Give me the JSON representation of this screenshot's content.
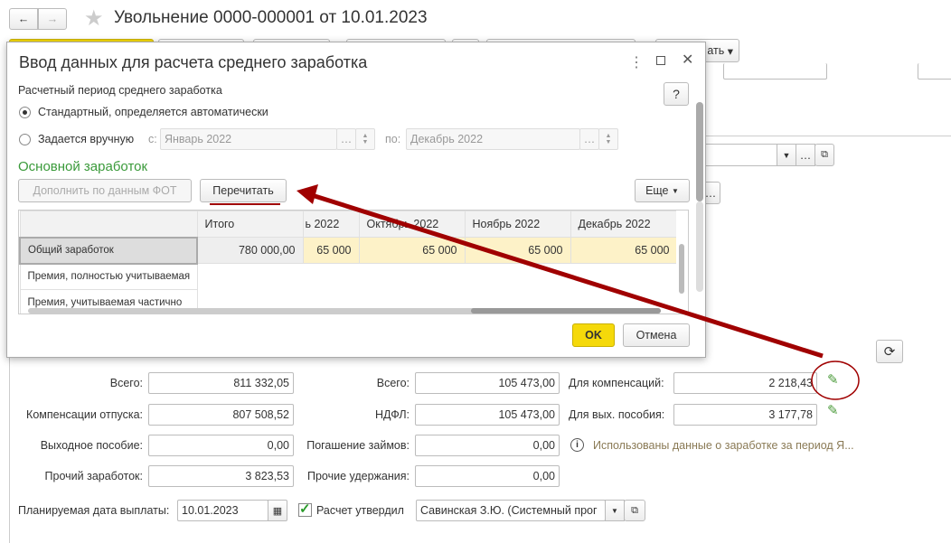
{
  "window": {
    "title": "Увольнение 0000-000001 от 10.01.2023",
    "toolbar_more_label": "ать"
  },
  "dialog": {
    "title": "Ввод данных для расчета среднего заработка",
    "help_label": "?",
    "period_label": "Расчетный период среднего заработка",
    "radio_auto": "Стандартный, определяется автоматически",
    "radio_manual": "Задается вручную",
    "from_label": "с:",
    "from_value": "Январь 2022",
    "to_label": "по:",
    "to_value": "Декабрь 2022",
    "section_title": "Основной заработок",
    "fill_button": "Дополнить по данным ФОТ",
    "recalc_button": "Перечитать",
    "more_button": "Еще",
    "table": {
      "headers": [
        "",
        "Итого",
        "ь 2022",
        "Октябрь 2022",
        "Ноябрь 2022",
        "Декабрь 2022"
      ],
      "rows": [
        [
          "Общий заработок",
          "780 000,00",
          "65 000",
          "65 000",
          "65 000",
          "65 000"
        ],
        [
          "Премия, полностью учитываемая",
          "",
          "",
          "",
          "",
          ""
        ],
        [
          "Премия, учитываемая частично",
          "",
          "",
          "",
          "",
          ""
        ]
      ]
    },
    "ok_button": "OK",
    "cancel_button": "Отмена"
  },
  "form": {
    "col1": [
      {
        "label": "Всего:",
        "value": "811 332,05"
      },
      {
        "label": "Компенсации отпуска:",
        "value": "807 508,52"
      },
      {
        "label": "Выходное пособие:",
        "value": "0,00"
      },
      {
        "label": "Прочий заработок:",
        "value": "3 823,53"
      }
    ],
    "col2": [
      {
        "label": "Всего:",
        "value": "105 473,00"
      },
      {
        "label": "НДФЛ:",
        "value": "105 473,00"
      },
      {
        "label": "Погашение займов:",
        "value": "0,00"
      },
      {
        "label": "Прочие удержания:",
        "value": "0,00"
      }
    ],
    "col3": [
      {
        "label": "Для компенсаций:",
        "value": "2 218,43"
      },
      {
        "label": "Для вых. пособия:",
        "value": "3 177,78"
      }
    ],
    "info_text": "Использованы данные о заработке за период Я...",
    "pay_date_label": "Планируемая дата выплаты:",
    "pay_date_value": "10.01.2023",
    "approved_label": "Расчет утвердил",
    "approved_checked": true,
    "approver_value": "Савинская З.Ю. (Системный прог"
  },
  "colors": {
    "accent_green": "#3a9a3a",
    "ok_yellow": "#f5d90a",
    "annotation_red": "#a00000",
    "highlight_row": "#fdf2c8"
  }
}
